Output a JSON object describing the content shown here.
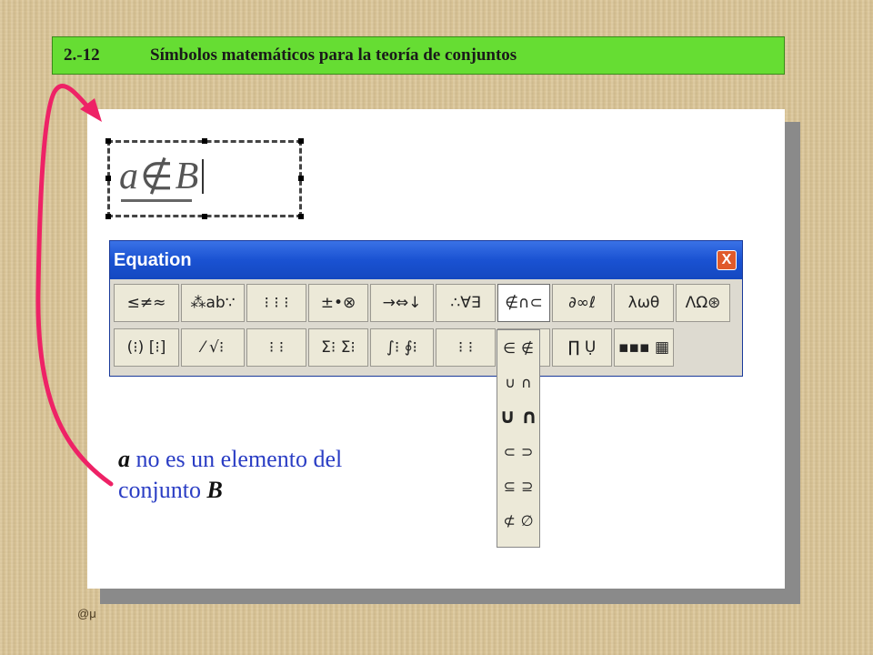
{
  "header": {
    "number": "2.-12",
    "title": "Símbolos matemáticos para la teoría de conjuntos"
  },
  "equation_box": {
    "left": "a",
    "symbol": "∉",
    "right": "B"
  },
  "equation_window": {
    "title": "Equation",
    "close_label": "X",
    "row1": [
      "≤≠≈",
      "⁂ab∵",
      "⁝ ⁝ ⁝",
      "±•⊗",
      "→⇔↓",
      "∴∀∃",
      "∉∩⊂",
      "∂∞ℓ",
      "λωθ",
      "ΛΩ⊛"
    ],
    "row2": [
      "(⁝) [⁝]",
      "⁄ √⁝",
      "⁝ ⁝",
      "Σ⁝ Σ⁝",
      "∫⁝ ∮⁝",
      "⁝ ⁝",
      "",
      "∏ Ụ",
      "▪▪▪ ▦"
    ],
    "active_button": "∉∩⊂",
    "dropdown": [
      {
        "a": "∈",
        "b": "∉"
      },
      {
        "a": "∪",
        "b": "∩"
      },
      {
        "a": "∪",
        "b": "∩"
      },
      {
        "a": "⊂",
        "b": "⊃"
      },
      {
        "a": "⊆",
        "b": "⊇"
      },
      {
        "a": "⊄",
        "b": "∅"
      }
    ]
  },
  "caption": {
    "var_a": "a",
    "line1_rest": " no es un elemento del",
    "line2_prefix": "conjunto ",
    "var_b": "B"
  },
  "footer": {
    "mark": "@μ"
  },
  "colors": {
    "title_bg": "#66dd33",
    "caption": "#2a3dc4",
    "arrow": "#ee2266",
    "window_title": "#1a52d2"
  }
}
